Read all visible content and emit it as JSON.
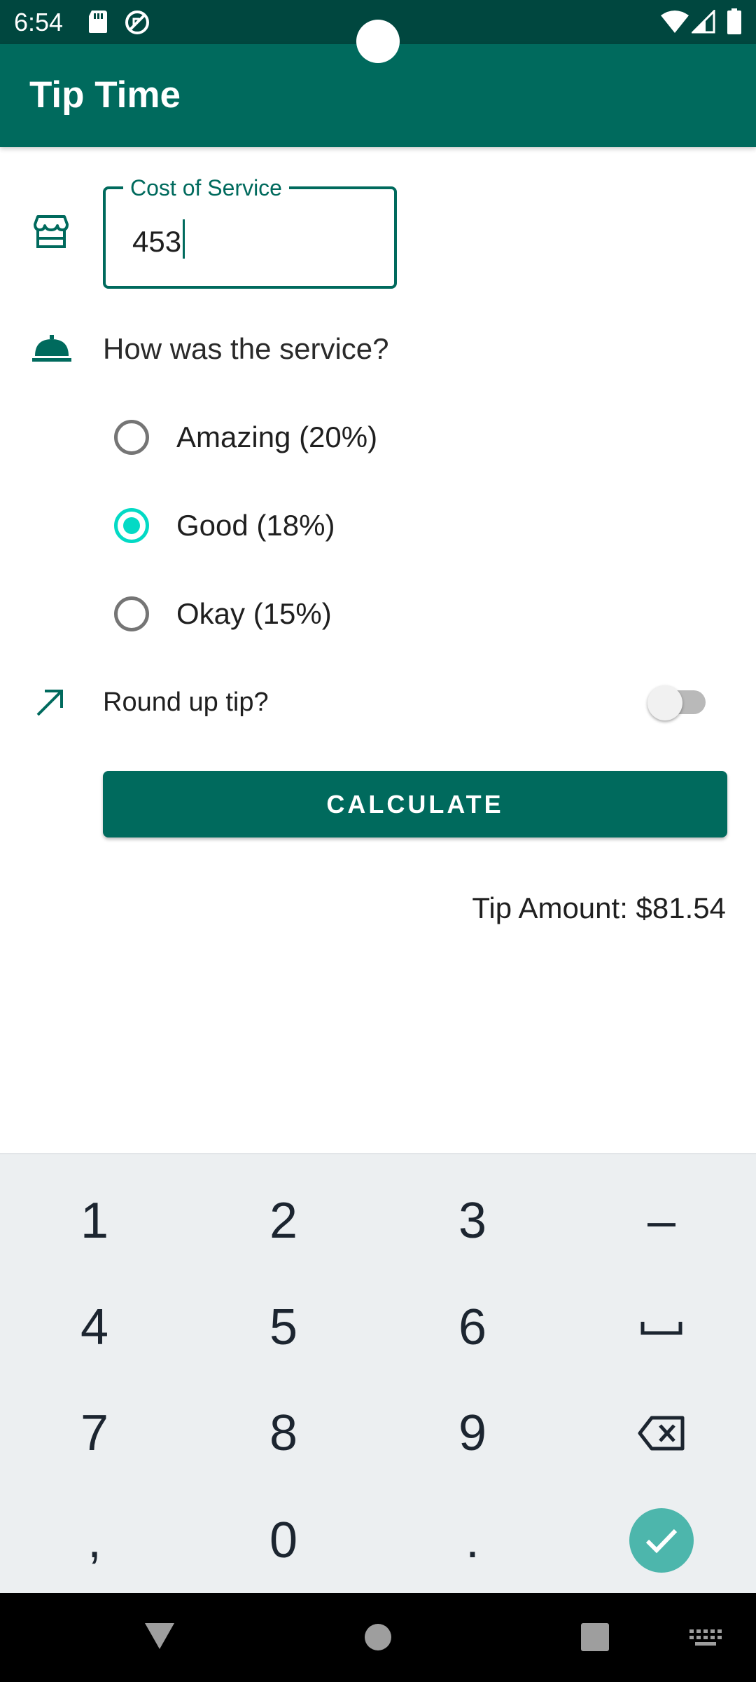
{
  "status_bar": {
    "time": "6:54",
    "icons": [
      "sd-card-icon",
      "no-disturb-icon",
      "wifi-icon",
      "signal-icon",
      "battery-icon"
    ]
  },
  "app_bar": {
    "title": "Tip Time"
  },
  "cost_field": {
    "label": "Cost of Service",
    "value": "453",
    "icon": "storefront-icon"
  },
  "service": {
    "question": "How was the service?",
    "icon": "room-service-bell-icon",
    "options": [
      {
        "label": "Amazing (20%)",
        "checked": false
      },
      {
        "label": "Good (18%)",
        "checked": true
      },
      {
        "label": "Okay (15%)",
        "checked": false
      }
    ]
  },
  "round_up": {
    "label": "Round up tip?",
    "enabled": false,
    "icon": "round-up-arrow-icon"
  },
  "calculate": {
    "label": "CALCULATE"
  },
  "result": {
    "text": "Tip Amount: $81.54"
  },
  "keyboard": {
    "keys": [
      "1",
      "2",
      "3",
      "–",
      "4",
      "5",
      "6",
      "space",
      "7",
      "8",
      "9",
      "backspace",
      ",",
      "0",
      ".",
      "done"
    ]
  },
  "nav_bar": {
    "buttons": [
      "back",
      "home",
      "recents",
      "keyboard-switch"
    ]
  },
  "colors": {
    "primary": "#006a5d",
    "status_bar": "#00473f",
    "accent": "#03dac5",
    "keyboard_bg": "#eceff1",
    "done_key": "#4db6ac"
  }
}
